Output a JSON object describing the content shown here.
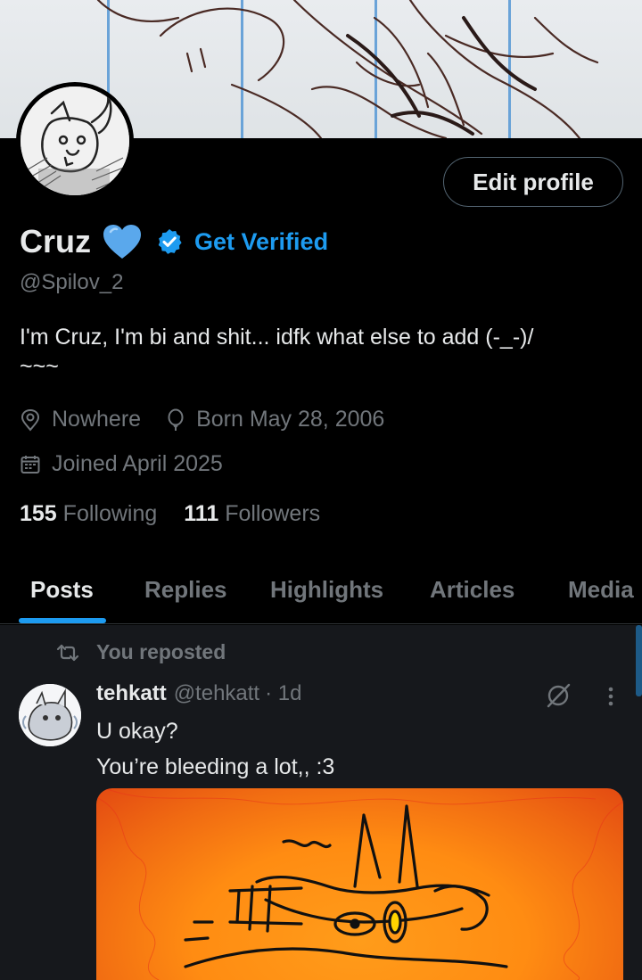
{
  "profile": {
    "edit_button": "Edit profile",
    "name": "Cruz",
    "get_verified": "Get Verified",
    "handle": "@Spilov_2",
    "bio_line1": "I'm Cruz, I'm bi and shit... idfk what else to add (-_-)/",
    "bio_line2": "~~~",
    "location": "Nowhere",
    "birthday": "Born May 28, 2006",
    "joined": "Joined April 2025",
    "following_count": "155",
    "following_label": "Following",
    "followers_count": "111",
    "followers_label": "Followers"
  },
  "tabs": [
    {
      "label": "Posts",
      "active": true
    },
    {
      "label": "Replies"
    },
    {
      "label": "Highlights"
    },
    {
      "label": "Articles"
    },
    {
      "label": "Media"
    }
  ],
  "post": {
    "repost_label": "You reposted",
    "author_name": "tehkatt",
    "author_handle": "@tehkatt",
    "time": "· 1d",
    "text_line1": "U okay?",
    "text_line2": "You’re bleeding a lot,, :3"
  },
  "colors": {
    "accent": "#1d9bf0",
    "heart": "#5aa8ec",
    "secondary_text": "#71767b"
  }
}
